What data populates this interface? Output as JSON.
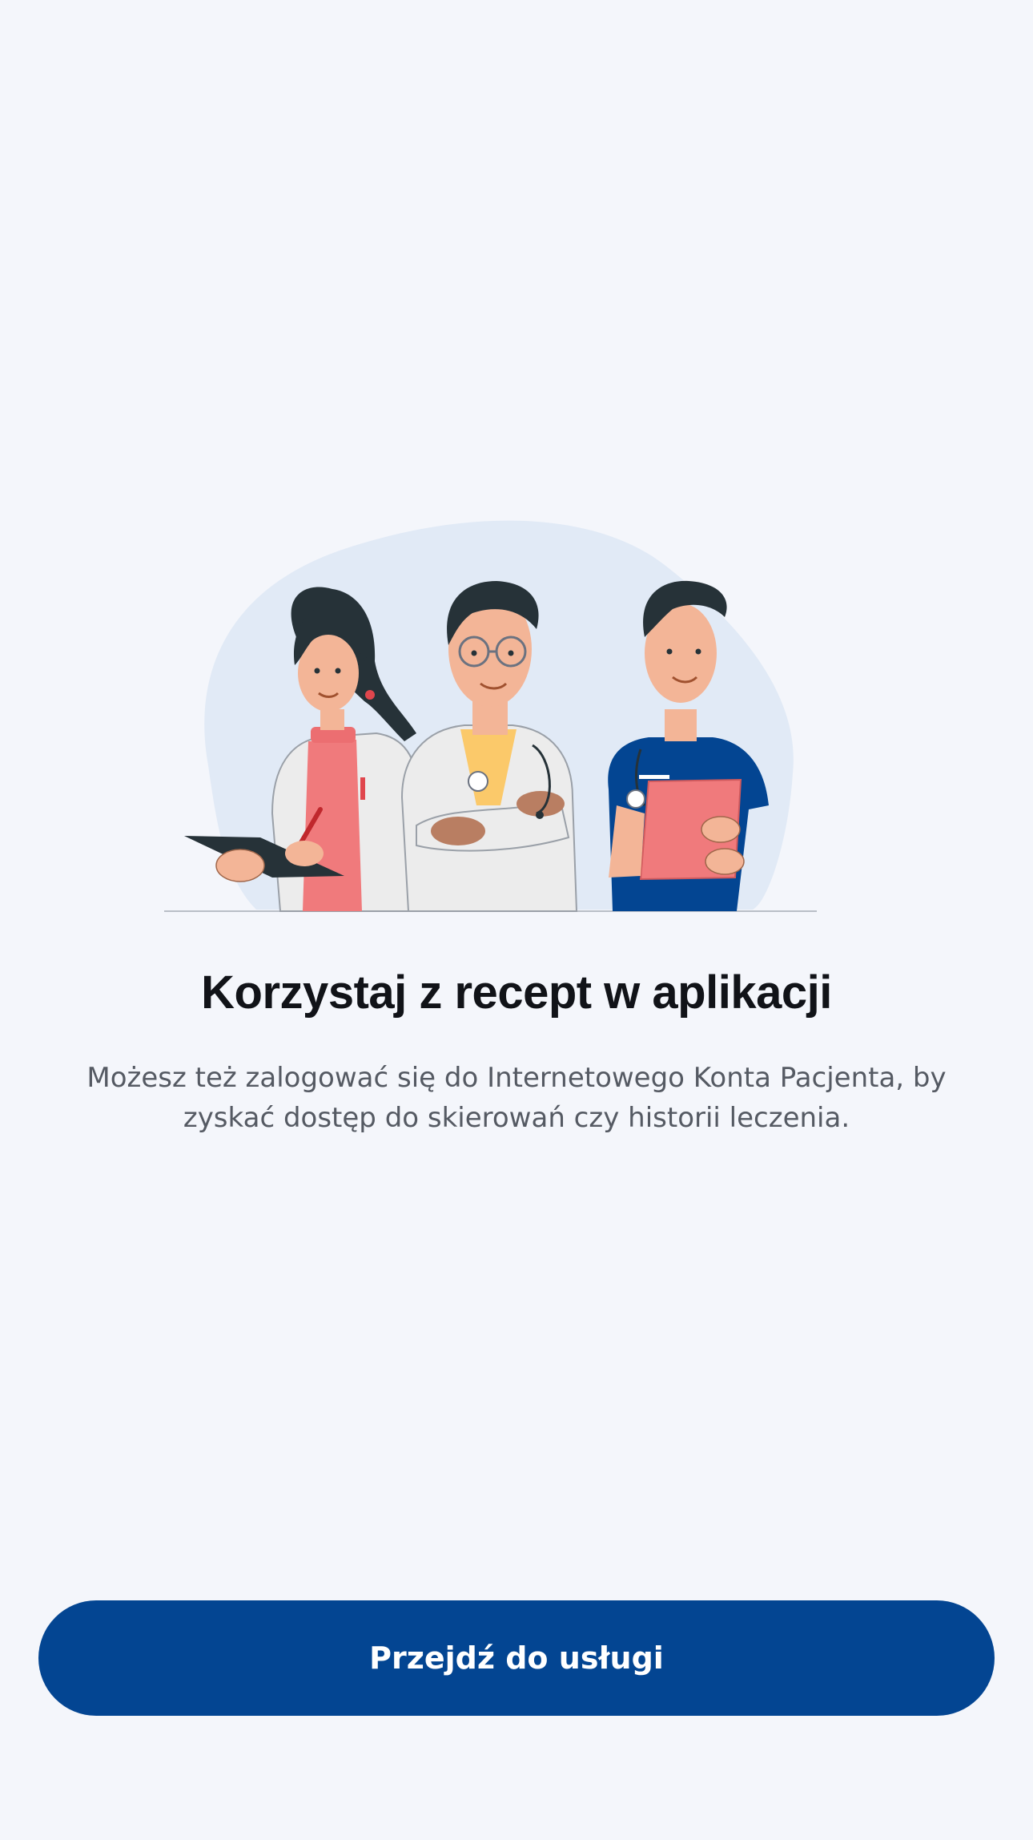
{
  "onboarding": {
    "illustration": "three-medical-staff-illustration",
    "title": "Korzystaj z recept w aplikacji",
    "subtitle": "Możesz też zalogować się do Internetowego Konta Pacjenta, by zyskać dostęp do skierowań czy historii leczenia.",
    "cta_label": "Przejdź do usługi"
  },
  "colors": {
    "background": "#f4f6fb",
    "accent": "#034592",
    "title": "#111318",
    "subtitle": "#555a63",
    "illustration_blob": "#e1eaf6"
  }
}
